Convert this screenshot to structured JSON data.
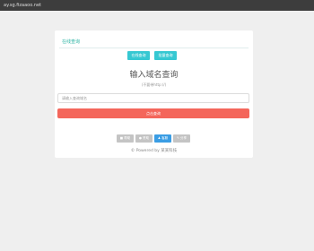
{
  "site": {
    "title": "ay.sg.fizaaoo.net"
  },
  "card": {
    "header": "在线查询",
    "tabs": [
      "在线查询",
      "批量查询"
    ],
    "title": "输入域名查询",
    "hint": "(不要带http://)",
    "input_placeholder": "请输入查询域名",
    "submit_label": "点击查询"
  },
  "footer": {
    "buttons": [
      "■ 帮助",
      "● 赞助",
      "♟ 客服",
      "✎ 分享"
    ],
    "powered": "© Powered by 某某科技"
  }
}
